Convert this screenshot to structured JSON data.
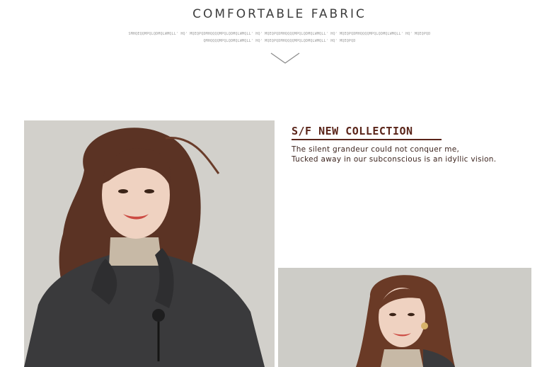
{
  "header": {
    "title": "COMFORTABLE FABRIC",
    "filler_line_1": "SMHQEQQMPQLQDMQLWMQLL' HQ' MQEQPQDMHQQQQMPQLQDMQLWMQLL' HQ' MQEQPQDMHQQQQMPQLQDMQLWMQLL' HQ' MQEQPQDMHQQQQMPQLQDMQLWMQLL' HQ' MQEQPQD",
    "filler_line_2": "QMHQQQQMPQLQDMQLWMQLL' HQ' MQEQPQDMHQQQQMPQLQDMQLWMQLL' HQ' MQEQPQD"
  },
  "collection": {
    "title": "S/F NEW COLLECTION",
    "line1": "The silent grandeur could not conquer me,",
    "line2": "Tucked away in our subconscious is an idyllic vision."
  },
  "icons": {
    "divider": "chevron-down-icon"
  },
  "colors": {
    "accent": "#5a2419",
    "text": "#3d3d3d",
    "photo_background": "#cfcdc8"
  }
}
